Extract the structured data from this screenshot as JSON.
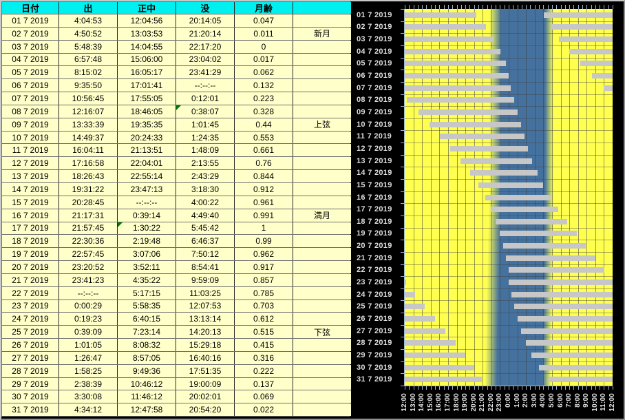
{
  "table": {
    "headers": [
      "日付",
      "出",
      "正中",
      "没",
      "月齢",
      ""
    ],
    "rows": [
      {
        "date": "01 7 2019",
        "rise": "4:04:53",
        "transit": "12:04:56",
        "set": "20:14:05",
        "age": "0.047",
        "phase": ""
      },
      {
        "date": "02 7 2019",
        "rise": "4:50:52",
        "transit": "13:03:53",
        "set": "21:20:14",
        "age": "0.011",
        "phase": "新月"
      },
      {
        "date": "03 7 2019",
        "rise": "5:48:39",
        "transit": "14:04:55",
        "set": "22:17:20",
        "age": "0",
        "phase": ""
      },
      {
        "date": "04 7 2019",
        "rise": "6:57:48",
        "transit": "15:06:00",
        "set": "23:04:02",
        "age": "0.017",
        "phase": ""
      },
      {
        "date": "05 7 2019",
        "rise": "8:15:02",
        "transit": "16:05:17",
        "set": "23:41:29",
        "age": "0.062",
        "phase": ""
      },
      {
        "date": "06 7 2019",
        "rise": "9:35:50",
        "transit": "17:01:41",
        "set": "--:--:--",
        "age": "0.132",
        "phase": ""
      },
      {
        "date": "07 7 2019",
        "rise": "10:56:45",
        "transit": "17:55:05",
        "set": "0:12:01",
        "age": "0.223",
        "phase": ""
      },
      {
        "date": "08 7 2019",
        "rise": "12:16:07",
        "transit": "18:46:05",
        "set": "0:38:07",
        "age": "0.328",
        "phase": "",
        "flags": {
          "set": true
        }
      },
      {
        "date": "09 7 2019",
        "rise": "13:33:39",
        "transit": "19:35:35",
        "set": "1:01:45",
        "age": "0.44",
        "phase": "上弦"
      },
      {
        "date": "10 7 2019",
        "rise": "14:49:37",
        "transit": "20:24:33",
        "set": "1:24:35",
        "age": "0.553",
        "phase": ""
      },
      {
        "date": "11 7 2019",
        "rise": "16:04:11",
        "transit": "21:13:51",
        "set": "1:48:09",
        "age": "0.661",
        "phase": ""
      },
      {
        "date": "12 7 2019",
        "rise": "17:16:58",
        "transit": "22:04:01",
        "set": "2:13:55",
        "age": "0.76",
        "phase": ""
      },
      {
        "date": "13 7 2019",
        "rise": "18:26:43",
        "transit": "22:55:14",
        "set": "2:43:29",
        "age": "0.844",
        "phase": ""
      },
      {
        "date": "14 7 2019",
        "rise": "19:31:22",
        "transit": "23:47:13",
        "set": "3:18:30",
        "age": "0.912",
        "phase": ""
      },
      {
        "date": "15 7 2019",
        "rise": "20:28:45",
        "transit": "--:--:--",
        "set": "4:00:22",
        "age": "0.961",
        "phase": ""
      },
      {
        "date": "16 7 2019",
        "rise": "21:17:31",
        "transit": "0:39:14",
        "set": "4:49:40",
        "age": "0.991",
        "phase": "満月"
      },
      {
        "date": "17 7 2019",
        "rise": "21:57:45",
        "transit": "1:30:22",
        "set": "5:45:42",
        "age": "1",
        "phase": "",
        "flags": {
          "transit": true
        }
      },
      {
        "date": "18 7 2019",
        "rise": "22:30:36",
        "transit": "2:19:48",
        "set": "6:46:37",
        "age": "0.99",
        "phase": ""
      },
      {
        "date": "19 7 2019",
        "rise": "22:57:45",
        "transit": "3:07:06",
        "set": "7:50:12",
        "age": "0.962",
        "phase": ""
      },
      {
        "date": "20 7 2019",
        "rise": "23:20:52",
        "transit": "3:52:11",
        "set": "8:54:41",
        "age": "0.917",
        "phase": ""
      },
      {
        "date": "21 7 2019",
        "rise": "23:41:23",
        "transit": "4:35:22",
        "set": "9:59:09",
        "age": "0.857",
        "phase": ""
      },
      {
        "date": "22 7 2019",
        "rise": "--:--:--",
        "transit": "5:17:15",
        "set": "11:03:25",
        "age": "0.785",
        "phase": ""
      },
      {
        "date": "23 7 2019",
        "rise": "0:00:29",
        "transit": "5:58:35",
        "set": "12:07:53",
        "age": "0.703",
        "phase": ""
      },
      {
        "date": "24 7 2019",
        "rise": "0:19:23",
        "transit": "6:40:15",
        "set": "13:13:14",
        "age": "0.612",
        "phase": ""
      },
      {
        "date": "25 7 2019",
        "rise": "0:39:09",
        "transit": "7:23:14",
        "set": "14:20:13",
        "age": "0.515",
        "phase": "下弦"
      },
      {
        "date": "26 7 2019",
        "rise": "1:01:05",
        "transit": "8:08:32",
        "set": "15:29:18",
        "age": "0.415",
        "phase": ""
      },
      {
        "date": "27 7 2019",
        "rise": "1:26:47",
        "transit": "8:57:05",
        "set": "16:40:16",
        "age": "0.316",
        "phase": ""
      },
      {
        "date": "28 7 2019",
        "rise": "1:58:25",
        "transit": "9:49:36",
        "set": "17:51:35",
        "age": "0.222",
        "phase": ""
      },
      {
        "date": "29 7 2019",
        "rise": "2:38:39",
        "transit": "10:46:12",
        "set": "19:00:09",
        "age": "0.137",
        "phase": ""
      },
      {
        "date": "30 7 2019",
        "rise": "3:30:08",
        "transit": "11:46:12",
        "set": "20:02:01",
        "age": "0.069",
        "phase": ""
      },
      {
        "date": "31 7 2019",
        "rise": "4:34:12",
        "transit": "12:47:58",
        "set": "20:54:20",
        "age": "0.022",
        "phase": ""
      }
    ]
  },
  "chart_data": {
    "type": "gantt",
    "title": "",
    "description": "moon-above-horizon bars per day on a noon-to-noon time axis; yellow = daylight, blue = night",
    "x_axis": {
      "labels": [
        "12:00",
        "13:00",
        "14:00",
        "15:00",
        "16:00",
        "17:00",
        "18:00",
        "19:00",
        "20:00",
        "21:00",
        "22:00",
        "23:00",
        "0:00",
        "1:00",
        "2:00",
        "3:00",
        "4:00",
        "5:00",
        "6:00",
        "7:00",
        "8:00",
        "9:00",
        "10:00",
        "11:00",
        "12:00"
      ],
      "minor_tick_minutes": 30,
      "major_grid_hours": 1,
      "range_hours": [
        12,
        36
      ]
    },
    "bars": [
      {
        "date": "01 7 2019",
        "segments": [
          [
            12,
            20.23
          ],
          [
            28.08,
            36
          ]
        ]
      },
      {
        "date": "02 7 2019",
        "segments": [
          [
            12,
            21.34
          ],
          [
            28.85,
            36
          ]
        ]
      },
      {
        "date": "03 7 2019",
        "segments": [
          [
            12,
            22.29
          ],
          [
            29.81,
            36
          ]
        ]
      },
      {
        "date": "04 7 2019",
        "segments": [
          [
            12,
            23.07
          ],
          [
            30.96,
            36
          ]
        ]
      },
      {
        "date": "05 7 2019",
        "segments": [
          [
            12,
            23.69
          ],
          [
            32.25,
            36
          ]
        ]
      },
      {
        "date": "06 7 2019",
        "segments": [
          [
            12,
            24.0
          ],
          [
            33.6,
            36
          ]
        ]
      },
      {
        "date": "07 7 2019",
        "segments": [
          [
            12,
            24.2
          ],
          [
            34.95,
            36
          ]
        ]
      },
      {
        "date": "08 7 2019",
        "segments": [
          [
            12.27,
            24.64
          ]
        ]
      },
      {
        "date": "09 7 2019",
        "segments": [
          [
            13.56,
            25.03
          ]
        ]
      },
      {
        "date": "10 7 2019",
        "segments": [
          [
            14.83,
            25.41
          ]
        ]
      },
      {
        "date": "11 7 2019",
        "segments": [
          [
            16.07,
            25.8
          ]
        ]
      },
      {
        "date": "12 7 2019",
        "segments": [
          [
            17.28,
            26.23
          ]
        ]
      },
      {
        "date": "13 7 2019",
        "segments": [
          [
            18.45,
            26.72
          ]
        ]
      },
      {
        "date": "14 7 2019",
        "segments": [
          [
            19.52,
            27.31
          ]
        ]
      },
      {
        "date": "15 7 2019",
        "segments": [
          [
            20.48,
            28.01
          ]
        ]
      },
      {
        "date": "16 7 2019",
        "segments": [
          [
            21.29,
            28.83
          ]
        ]
      },
      {
        "date": "17 7 2019",
        "segments": [
          [
            21.96,
            29.76
          ]
        ]
      },
      {
        "date": "18 7 2019",
        "segments": [
          [
            22.51,
            30.78
          ]
        ]
      },
      {
        "date": "19 7 2019",
        "segments": [
          [
            22.96,
            31.84
          ]
        ]
      },
      {
        "date": "20 7 2019",
        "segments": [
          [
            23.35,
            32.91
          ]
        ]
      },
      {
        "date": "21 7 2019",
        "segments": [
          [
            23.69,
            33.99
          ]
        ]
      },
      {
        "date": "22 7 2019",
        "segments": [
          [
            24.0,
            35.06
          ]
        ]
      },
      {
        "date": "23 7 2019",
        "segments": [
          [
            12,
            12.13
          ],
          [
            24.01,
            36
          ]
        ]
      },
      {
        "date": "24 7 2019",
        "segments": [
          [
            12,
            13.22
          ],
          [
            24.32,
            36
          ]
        ]
      },
      {
        "date": "25 7 2019",
        "segments": [
          [
            12,
            14.34
          ],
          [
            24.65,
            36
          ]
        ]
      },
      {
        "date": "26 7 2019",
        "segments": [
          [
            12,
            15.49
          ],
          [
            25.02,
            36
          ]
        ]
      },
      {
        "date": "27 7 2019",
        "segments": [
          [
            12,
            16.67
          ],
          [
            25.45,
            36
          ]
        ]
      },
      {
        "date": "28 7 2019",
        "segments": [
          [
            12,
            17.86
          ],
          [
            25.97,
            36
          ]
        ]
      },
      {
        "date": "29 7 2019",
        "segments": [
          [
            12,
            19.0
          ],
          [
            26.64,
            36
          ]
        ]
      },
      {
        "date": "30 7 2019",
        "segments": [
          [
            12,
            20.03
          ],
          [
            27.5,
            36
          ]
        ]
      },
      {
        "date": "31 7 2019",
        "segments": [
          [
            12,
            20.91
          ],
          [
            28.57,
            36
          ]
        ]
      }
    ],
    "night_band": {
      "axis_note": "hours on noon-to-noon axis: 12=noon, 24=midnight, 36=next noon",
      "dusk_center_top": 22.45,
      "dusk_center_bottom": 21.95,
      "dusk_hold_rows": 15,
      "dawn_center_top": 28.67,
      "dawn_center_bottom": 28.4,
      "dawn_hold_rows": 18,
      "dusk_halfwidth": 0.7,
      "dawn_halfwidth": 0.5
    },
    "colors": {
      "day": "#FFFF4F",
      "night": "#44719E",
      "bar": "#C7C7C7",
      "background": "#000000",
      "axis": "#9FB6CF",
      "grid": "#424242",
      "label": "#DFDFDF",
      "table_header_bg": "#00F0F0",
      "table_cell_bg": "#FFFFC9",
      "note_marker": "#067806"
    }
  }
}
